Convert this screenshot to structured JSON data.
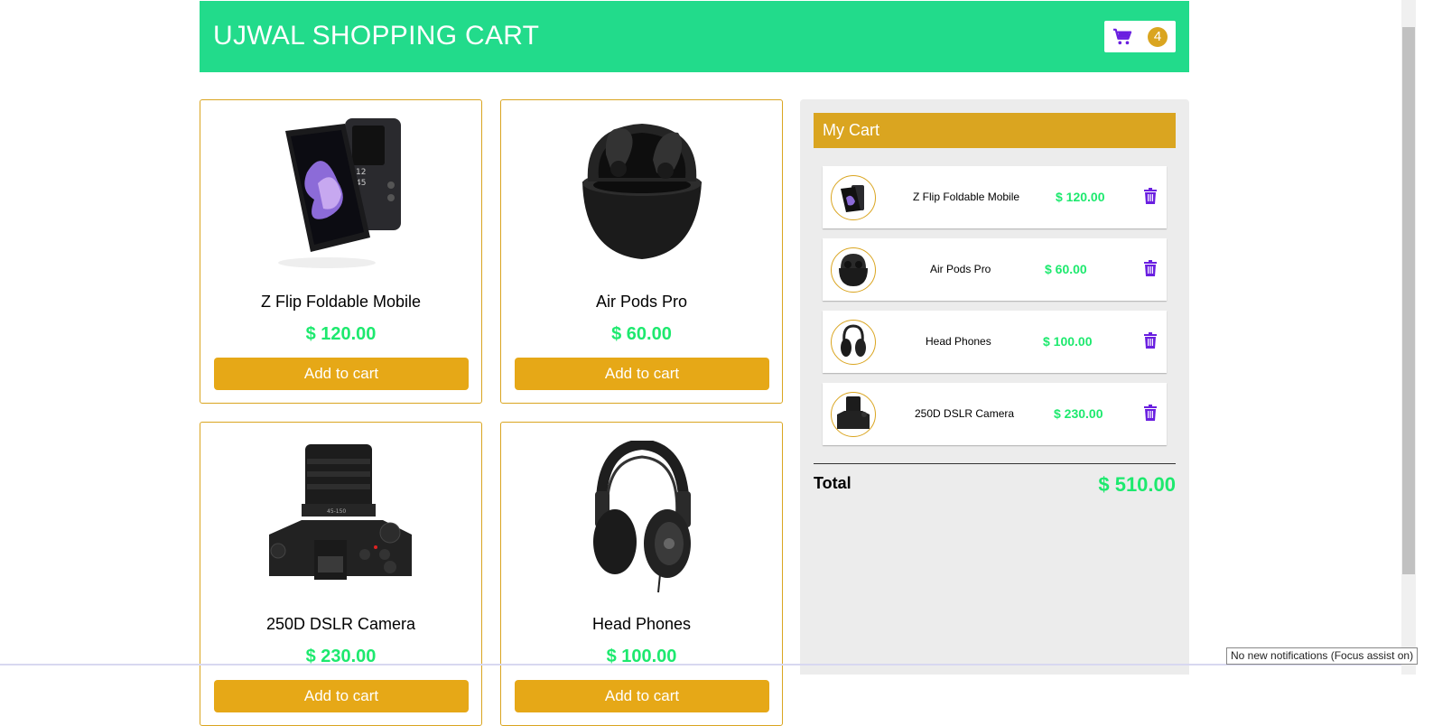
{
  "header": {
    "title": "UJWAL SHOPPING CART",
    "cart_count": "4",
    "cart_icon": "shopping-cart-icon",
    "accent_color": "#22db8b"
  },
  "products": [
    {
      "name": "Z Flip Foldable Mobile",
      "price": "$ 120.00",
      "button": "Add to cart",
      "image": "foldable-phone-image"
    },
    {
      "name": "Air Pods Pro",
      "price": "$ 60.00",
      "button": "Add to cart",
      "image": "earbuds-image"
    },
    {
      "name": "250D DSLR Camera",
      "price": "$ 230.00",
      "button": "Add to cart",
      "image": "camera-image"
    },
    {
      "name": "Head Phones",
      "price": "$ 100.00",
      "button": "Add to cart",
      "image": "headphones-image"
    }
  ],
  "cart": {
    "title": "My Cart",
    "items": [
      {
        "name": "Z Flip Foldable Mobile",
        "price": "$ 120.00"
      },
      {
        "name": "Air Pods Pro",
        "price": "$ 60.00"
      },
      {
        "name": "Head Phones",
        "price": "$ 100.00"
      },
      {
        "name": "250D DSLR Camera",
        "price": "$ 230.00"
      }
    ],
    "total_label": "Total",
    "total_value": "$ 510.00",
    "delete_icon": "trash-icon"
  },
  "colors": {
    "price_green": "#1de96e",
    "gold": "#daa520",
    "button": "#e6a817",
    "icon_purple": "#6a1fe0"
  },
  "system": {
    "notification": "No new notifications (Focus assist on)"
  }
}
